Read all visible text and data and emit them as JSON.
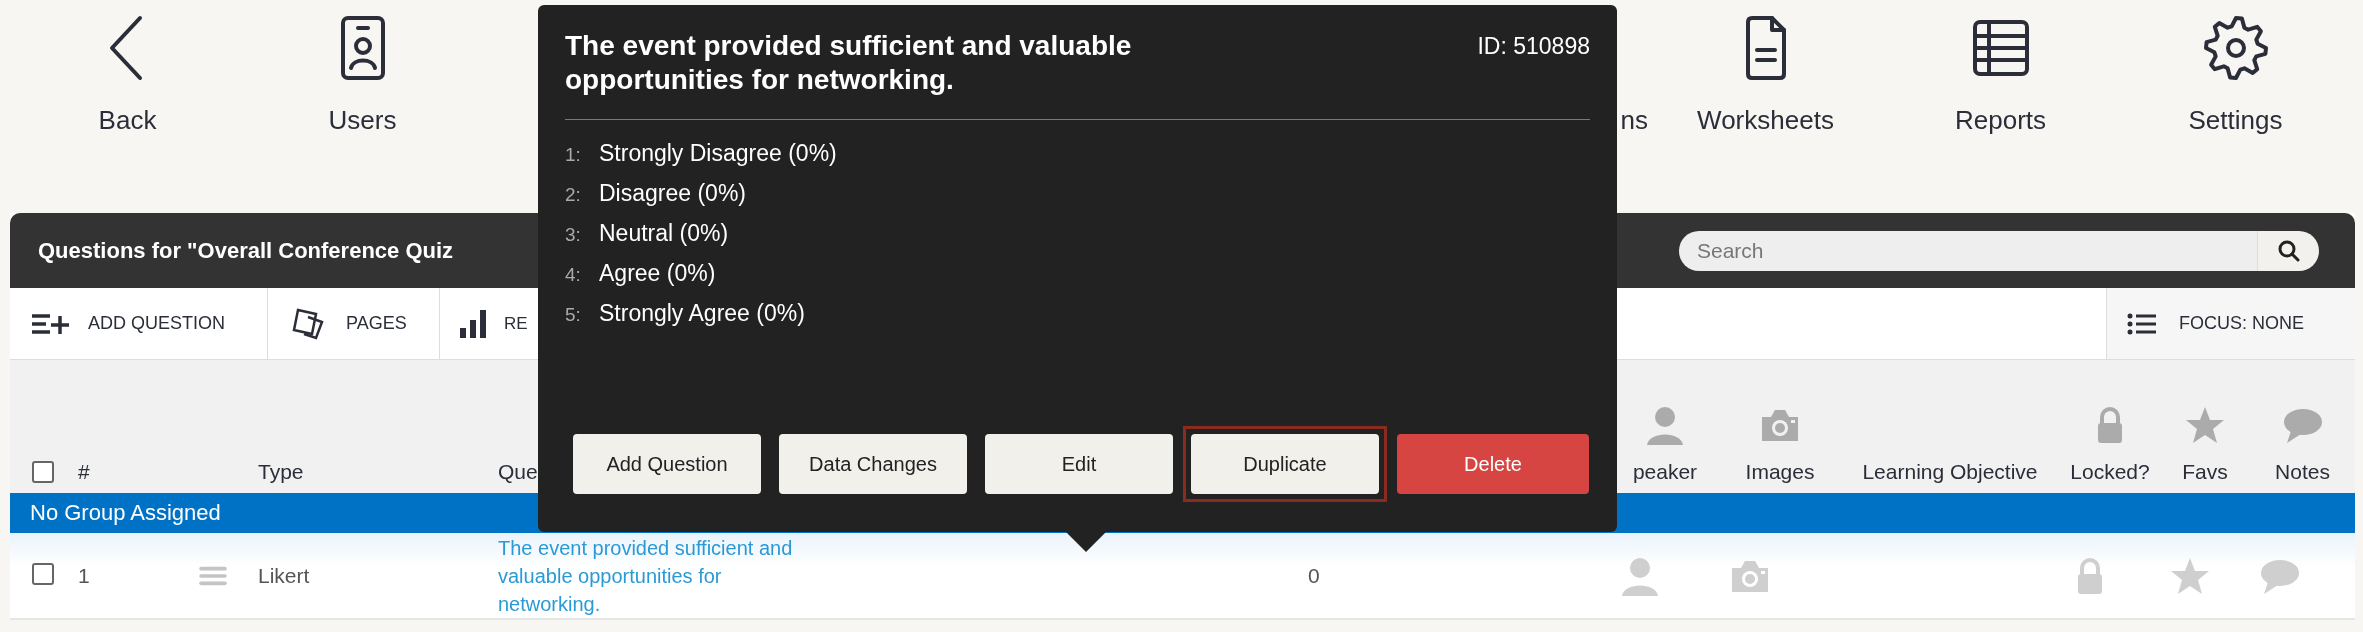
{
  "nav": [
    {
      "label": "Back"
    },
    {
      "label": "Users"
    },
    {
      "label": "ns"
    },
    {
      "label": "Worksheets"
    },
    {
      "label": "Reports"
    },
    {
      "label": "Settings"
    }
  ],
  "panel": {
    "title": "Questions for \"Overall Conference Quiz",
    "search": {
      "placeholder": "Search"
    }
  },
  "toolbar": {
    "items": [
      {
        "label": "ADD QUESTION"
      },
      {
        "label": "PAGES"
      },
      {
        "label": "RE"
      }
    ],
    "focus": {
      "label": "FOCUS: NONE"
    }
  },
  "table": {
    "header_checked": false,
    "columns": [
      {
        "label": "#"
      },
      {
        "label": "Type"
      },
      {
        "label": "Que"
      },
      {
        "label": "peaker"
      },
      {
        "label": "Images"
      },
      {
        "label": "Learning Objective"
      },
      {
        "label": "Locked?"
      },
      {
        "label": "Favs"
      },
      {
        "label": "Notes"
      }
    ],
    "group": "No Group Assigned",
    "rows": [
      {
        "checked": false,
        "number": "1",
        "type": "Likert",
        "question": "The event provided sufficient and valuable opportunities for networking.",
        "count": "0"
      }
    ]
  },
  "popup": {
    "title": "The event provided sufficient and valuable opportunities for networking.",
    "id": "ID: 510898",
    "options": [
      {
        "number": "1:",
        "label": "Strongly Disagree (0%)"
      },
      {
        "number": "2:",
        "label": "Disagree (0%)"
      },
      {
        "number": "3:",
        "label": "Neutral (0%)"
      },
      {
        "number": "4:",
        "label": "Agree (0%)"
      },
      {
        "number": "5:",
        "label": "Strongly Agree (0%)"
      }
    ],
    "buttons": [
      {
        "label": "Add Question",
        "kind": "default",
        "highlighted": false
      },
      {
        "label": "Data Changes",
        "kind": "default",
        "highlighted": false
      },
      {
        "label": "Edit",
        "kind": "default",
        "highlighted": false
      },
      {
        "label": "Duplicate",
        "kind": "default",
        "highlighted": true
      },
      {
        "label": "Delete",
        "kind": "danger",
        "highlighted": false
      }
    ]
  }
}
